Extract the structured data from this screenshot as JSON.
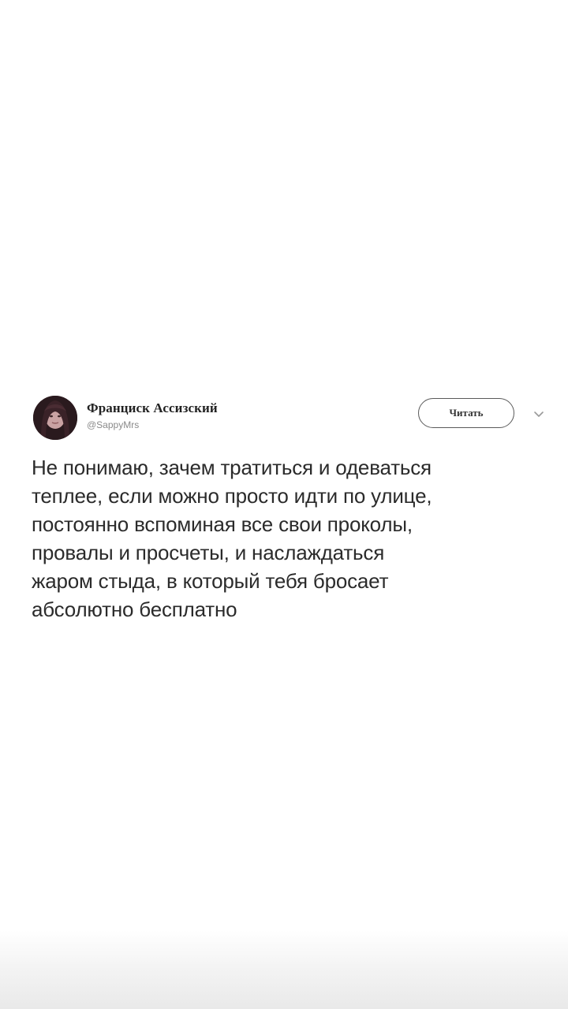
{
  "author": {
    "name": "Франциск Ассизский",
    "handle": "@SappyMrs",
    "avatar_icon": "profile-photo"
  },
  "follow_button": {
    "label": "Читать"
  },
  "menu_caret_icon": "chevron-down-icon",
  "tweet": {
    "text": "Не понимаю, зачем тратиться и одеваться\nтеплее, если можно просто идти по улице,\nпостоянно вспоминая все свои проколы,\nпровалы и просчеты, и наслаждаться\nжаром стыда, в который тебя бросает\nабсолютно бесплатно"
  },
  "colors": {
    "background": "#ffffff",
    "text": "#2b2b2b",
    "handle": "#8a8a8a",
    "button_border": "#5a5a5a"
  }
}
